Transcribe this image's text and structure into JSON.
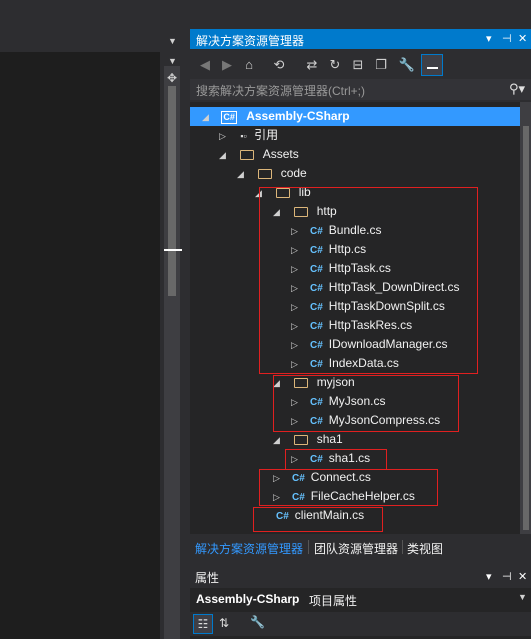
{
  "solution_explorer": {
    "title": "解决方案资源管理器",
    "title_buttons": [
      "▾",
      "⊣",
      "✕"
    ],
    "search_placeholder": "搜索解决方案资源管理器(Ctrl+;)",
    "toolbar_icons": [
      "back-icon",
      "forward-icon",
      "home-icon",
      "history-icon",
      "sync-icon",
      "refresh-icon",
      "collapse-icon",
      "copy-icon",
      "properties-wrench-icon",
      "preview-icon"
    ],
    "tree": [
      {
        "label": "Assembly-CSharp",
        "kind": "project",
        "arrow": "◢",
        "selected": true
      },
      {
        "label": "引用",
        "kind": "references",
        "arrow": "▷"
      },
      {
        "label": "Assets",
        "kind": "folder",
        "arrow": "◢"
      },
      {
        "label": "code",
        "kind": "folder",
        "arrow": "◢"
      },
      {
        "label": "lib",
        "kind": "folder",
        "arrow": "◢"
      },
      {
        "label": "http",
        "kind": "folder",
        "arrow": "◢"
      },
      {
        "label": "Bundle.cs",
        "kind": "cs",
        "arrow": "▷"
      },
      {
        "label": "Http.cs",
        "kind": "cs",
        "arrow": "▷"
      },
      {
        "label": "HttpTask.cs",
        "kind": "cs",
        "arrow": "▷"
      },
      {
        "label": "HttpTask_DownDirect.cs",
        "kind": "cs",
        "arrow": "▷"
      },
      {
        "label": "HttpTaskDownSplit.cs",
        "kind": "cs",
        "arrow": "▷"
      },
      {
        "label": "HttpTaskRes.cs",
        "kind": "cs",
        "arrow": "▷"
      },
      {
        "label": "IDownloadManager.cs",
        "kind": "cs",
        "arrow": "▷"
      },
      {
        "label": "IndexData.cs",
        "kind": "cs",
        "arrow": "▷"
      },
      {
        "label": "myjson",
        "kind": "folder",
        "arrow": "◢"
      },
      {
        "label": "MyJson.cs",
        "kind": "cs",
        "arrow": "▷"
      },
      {
        "label": "MyJsonCompress.cs",
        "kind": "cs",
        "arrow": "▷"
      },
      {
        "label": "sha1",
        "kind": "folder",
        "arrow": "◢"
      },
      {
        "label": "sha1.cs",
        "kind": "cs",
        "arrow": "▷"
      },
      {
        "label": "Connect.cs",
        "kind": "cs",
        "arrow": "▷"
      },
      {
        "label": "FileCacheHelper.cs",
        "kind": "cs",
        "arrow": "▷"
      },
      {
        "label": "clientMain.cs",
        "kind": "cs",
        "arrow": ""
      }
    ],
    "cs_glyph": "C#",
    "tabs": [
      "解决方案资源管理器",
      "团队资源管理器",
      "类视图"
    ]
  },
  "properties": {
    "title": "属性",
    "title_buttons": [
      "▾",
      "⊣",
      "✕"
    ],
    "object_name": "Assembly-CSharp",
    "object_type": "项目属性"
  },
  "colors": {
    "accent": "#007acc",
    "selection": "#3399ff",
    "annotation": "#e02020"
  }
}
